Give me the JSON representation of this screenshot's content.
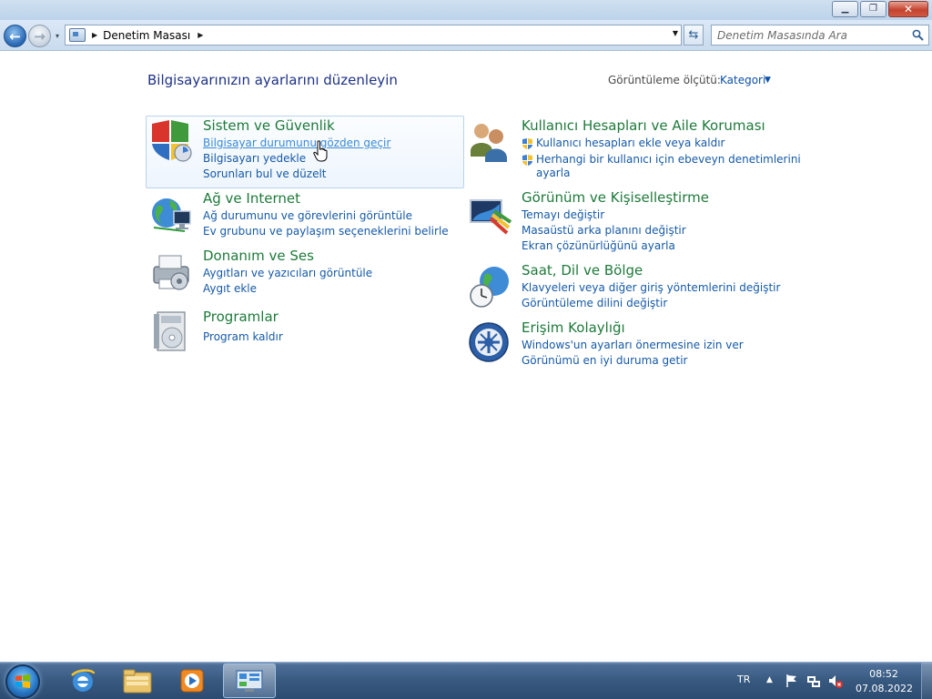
{
  "window": {
    "minimize_icon": "minimize-icon",
    "maximize_icon": "restore-icon",
    "close_icon": "close-icon",
    "minimize_glyph": "▁",
    "maximize_glyph": "❐",
    "close_glyph": "✕"
  },
  "nav": {
    "back_glyph": "←",
    "forward_glyph": "→",
    "recent_glyph": "▾",
    "breadcrumb": [
      "Denetim Masası"
    ],
    "breadcrumb_sep": "▶",
    "dropdown_glyph": "▼",
    "refresh_glyph": "⇆",
    "search_placeholder": "Denetim Masasında Ara"
  },
  "main": {
    "title": "Bilgisayarınızın ayarlarını düzenleyin",
    "view_by_label": "Görüntüleme ölçütü:",
    "view_by_value": "Kategori",
    "view_by_caret": "▼"
  },
  "categories_left": [
    {
      "title": "Sistem ve Güvenlik",
      "icon": "shield-icon",
      "links": [
        "Bilgisayar durumunu gözden geçir",
        "Bilgisayarı yedekle",
        "Sorunları bul ve düzelt"
      ]
    },
    {
      "title": "Ağ ve Internet",
      "icon": "network-globe-icon",
      "links": [
        "Ağ durumunu ve görevlerini görüntüle",
        "Ev grubunu ve paylaşım seçeneklerini belirle"
      ]
    },
    {
      "title": "Donanım ve Ses",
      "icon": "printer-icon",
      "links": [
        "Aygıtları ve yazıcıları görüntüle",
        "Aygıt ekle"
      ]
    },
    {
      "title": "Programlar",
      "icon": "programs-disc-icon",
      "links": [
        "Program kaldır"
      ]
    }
  ],
  "categories_right": [
    {
      "title": "Kullanıcı Hesapları ve Aile Koruması",
      "icon": "users-icon",
      "links": [
        "Kullanıcı hesapları ekle veya kaldır",
        "Herhangi bir kullanıcı için ebeveyn denetimlerini",
        "ayarla"
      ]
    },
    {
      "title": "Görünüm ve Kişiselleştirme",
      "icon": "personalization-icon",
      "links": [
        "Temayı değiştir",
        "Masaüstü arka planını değiştir",
        "Ekran çözünürlüğünü ayarla"
      ]
    },
    {
      "title": "Saat, Dil ve Bölge",
      "icon": "clock-globe-icon",
      "links": [
        "Klavyeleri veya diğer giriş yöntemlerini değiştir",
        "Görüntüleme dilini değiştir"
      ]
    },
    {
      "title": "Erişim Kolaylığı",
      "icon": "ease-of-access-icon",
      "links": [
        "Windows'un ayarları önermesine izin ver",
        "Görünümü en iyi duruma getir"
      ]
    }
  ],
  "taskbar": {
    "start_icon": "windows-start-icon",
    "pinned": [
      "internet-explorer-icon",
      "windows-explorer-icon",
      "media-player-icon",
      "control-panel-icon"
    ],
    "language": "TR",
    "tray_up_glyph": "▲",
    "tray_icons": [
      "action-center-flag-icon",
      "network-icon",
      "volume-muted-icon"
    ],
    "time": "08:52",
    "date": "07.08.2022"
  }
}
